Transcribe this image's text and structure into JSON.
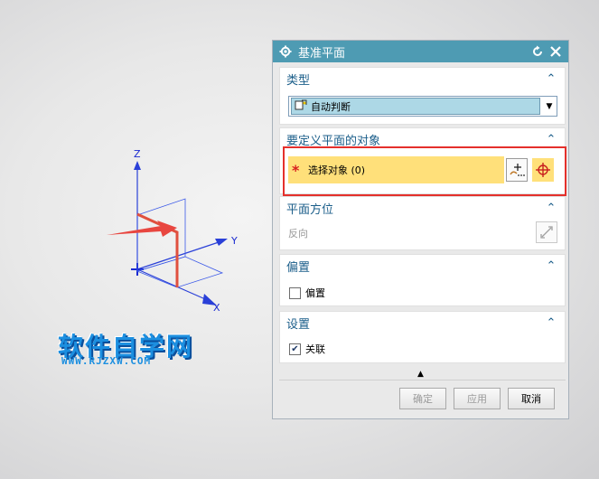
{
  "viewport": {
    "axes": {
      "x_label": "X",
      "y_label": "Y",
      "z_label": "Z"
    },
    "watermark": {
      "cn": "软件自学网",
      "en": "WWW.RJZXW.COM"
    }
  },
  "dialog": {
    "title": "基准平面",
    "icons": {
      "title_icon": "gear-icon",
      "reset": "reset-icon",
      "close": "close-icon"
    },
    "sections": {
      "type": {
        "label": "类型",
        "selected": "自动判断"
      },
      "objects": {
        "label": "要定义平面的对象",
        "select_text": "选择对象 (0)"
      },
      "orientation": {
        "label": "平面方位",
        "reverse_label": "反向"
      },
      "offset": {
        "label": "偏置",
        "checkbox_label": "偏置",
        "checked": false
      },
      "settings": {
        "label": "设置",
        "checkbox_label": "关联",
        "checked": true
      }
    },
    "buttons": {
      "ok": "确定",
      "apply": "应用",
      "cancel": "取消"
    }
  }
}
